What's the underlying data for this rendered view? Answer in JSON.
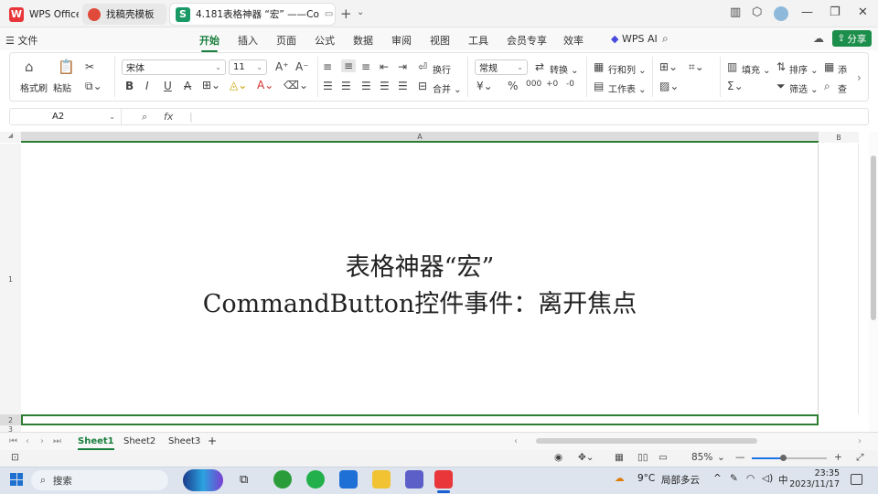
{
  "tabs": {
    "app_name": "WPS Office",
    "template_tab": "找稿壳模板",
    "doc_tab": "4.181表格神器 “宏” ——Co"
  },
  "menu": [
    "文件",
    "开始",
    "插入",
    "页面",
    "公式",
    "数据",
    "审阅",
    "视图",
    "工具",
    "会员专享",
    "效率",
    "WPS AI"
  ],
  "menu_active": "开始",
  "share_label": "分享",
  "ribbon": {
    "format_painter": "格式刷",
    "paste": "粘贴",
    "font_name": "宋体",
    "font_size": "11",
    "wrap": "换行",
    "merge": "合并",
    "number_format": "常规",
    "convert": "转换",
    "rows_cols": "行和列",
    "worksheet": "工作表",
    "fill": "填充",
    "sort": "排序",
    "filter": "筛选",
    "add": "添",
    "find": "查"
  },
  "formula_bar": {
    "cell_ref": "A2",
    "fx": "fx",
    "content": ""
  },
  "grid": {
    "col_a": "A",
    "col_b": "B",
    "row1": "1",
    "row2": "2",
    "row3": "3",
    "cell_line1": "表格神器“宏”",
    "cell_line2": "CommandButton控件事件：离开焦点"
  },
  "sheets": [
    "Sheet1",
    "Sheet2",
    "Sheet3"
  ],
  "active_sheet": "Sheet1",
  "status": {
    "zoom": "85%"
  },
  "taskbar": {
    "search_placeholder": "搜索",
    "weather_temp": "9°C",
    "weather_desc": "局部多云",
    "ime": "中",
    "time": "23:35",
    "date": "2023/11/17"
  },
  "colors": {
    "accent_green": "#1a7f3d",
    "wps_red": "#e8363a"
  }
}
